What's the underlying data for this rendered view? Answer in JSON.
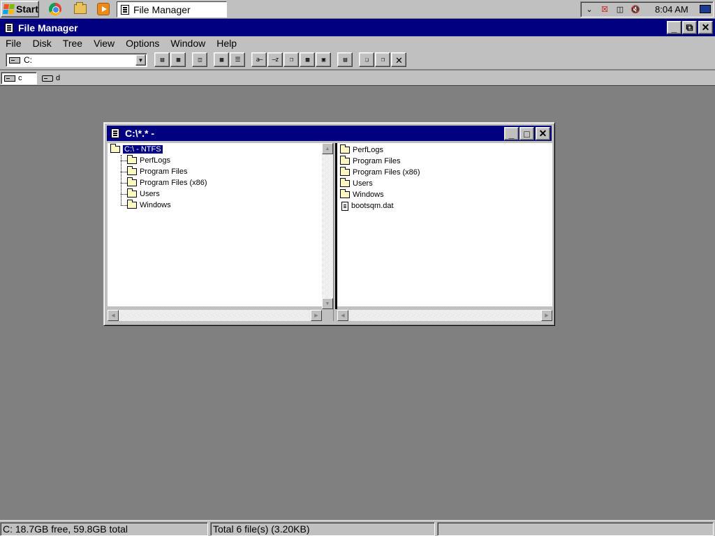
{
  "taskbar": {
    "start_label": "Start",
    "task_label": "File Manager",
    "clock": "8:04 AM",
    "quick_launch": [
      "chrome-icon",
      "explorer-icon",
      "media-player-icon"
    ],
    "tray_icons": [
      "chevron-down-icon",
      "network-error-icon",
      "network-icon",
      "volume-muted-icon"
    ]
  },
  "app": {
    "title": "File Manager",
    "menu": [
      "File",
      "Disk",
      "Tree",
      "View",
      "Options",
      "Window",
      "Help"
    ],
    "drive_combo": "C:",
    "drive_buttons": [
      {
        "label": "c",
        "icon": "hard-drive-icon"
      },
      {
        "label": "d",
        "icon": "cdrom-drive-icon"
      }
    ],
    "toolbar_buttons": [
      "connect-network-drive",
      "disconnect-network-drive",
      "share-as",
      "large-icons-view",
      "list-view",
      "sort-by-name",
      "sort-by-type",
      "sort-by-size",
      "sort-by-date",
      "details-view",
      "new-window",
      "copy",
      "paste",
      "delete"
    ]
  },
  "child_window": {
    "title": "C:\\*.* -",
    "tree": {
      "root": "C:\\ - NTFS",
      "items": [
        "PerfLogs",
        "Program Files",
        "Program Files (x86)",
        "Users",
        "Windows"
      ]
    },
    "files": [
      {
        "name": "PerfLogs",
        "type": "folder"
      },
      {
        "name": "Program Files",
        "type": "folder"
      },
      {
        "name": "Program Files (x86)",
        "type": "folder"
      },
      {
        "name": "Users",
        "type": "folder"
      },
      {
        "name": "Windows",
        "type": "folder"
      },
      {
        "name": "bootsqm.dat",
        "type": "file"
      }
    ]
  },
  "status": {
    "left": "C: 18.7GB free,  59.8GB total",
    "middle": "Total 6 file(s) (3.20KB)",
    "right": ""
  }
}
